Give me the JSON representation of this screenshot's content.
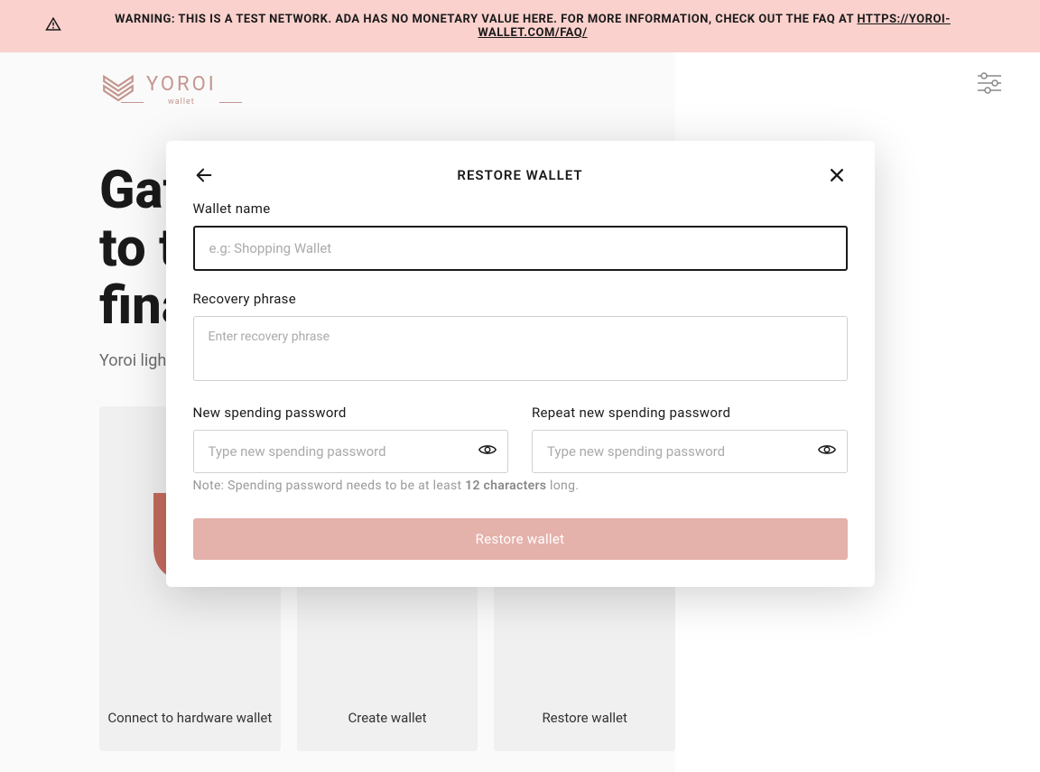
{
  "warning": {
    "prefix": "WARNING: THIS IS A TEST NETWORK. ADA HAS NO MONETARY VALUE HERE. FOR MORE INFORMATION, CHECK OUT THE FAQ AT ",
    "link": "HTTPS://YOROI-WALLET.COM/FAQ/"
  },
  "logo": {
    "name": "YOROI",
    "sub": "wallet"
  },
  "hero": {
    "line1": "Gateway",
    "line2": "to the",
    "line3": "financial world",
    "sub": "Yoroi light wallet for Cardano"
  },
  "cards": {
    "hw": "Connect to hardware wallet",
    "create": "Create wallet",
    "restore": "Restore wallet"
  },
  "modal": {
    "title": "RESTORE WALLET",
    "wallet_name_label": "Wallet name",
    "wallet_name_placeholder": "e.g: Shopping Wallet",
    "recovery_label": "Recovery phrase",
    "recovery_placeholder": "Enter recovery phrase",
    "new_pw_label": "New spending password",
    "repeat_pw_label": "Repeat new spending password",
    "pw_placeholder": "Type new spending password",
    "note_prefix": "Note: Spending password needs to be at least ",
    "note_bold": "12 characters",
    "note_suffix": " long.",
    "submit": "Restore wallet"
  },
  "colors": {
    "accent": "#e5b1ab",
    "warning_bg": "#fad1cd"
  }
}
